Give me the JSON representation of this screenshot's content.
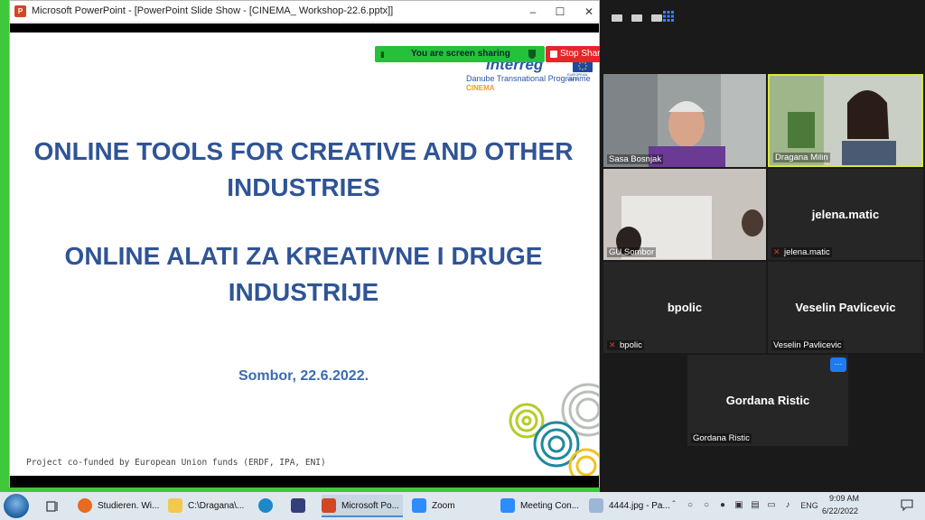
{
  "ppt_window": {
    "title": "Microsoft PowerPoint - [PowerPoint Slide Show - [CINEMA_ Workshop-22.6.pptx]]",
    "app_icon_letter": "P"
  },
  "slide": {
    "title_en": "ONLINE TOOLS FOR CREATIVE AND OTHER INDUSTRIES",
    "title_sr": "ONLINE ALATI ZA KREATIVNE I DRUGE INDUSTRIJE",
    "date": "Sombor, 22.6.2022.",
    "footer": "Project co-funded by European Union funds (ERDF, IPA, ENI)",
    "logo": {
      "brand": "interreg",
      "programme": "Danube Transnational Programme",
      "project": "CINEMA",
      "eu_label": "EUROPEAN UNION"
    }
  },
  "share_bar": {
    "status": "You are screen sharing",
    "stop_label": "Stop Share"
  },
  "zoom": {
    "participants": [
      {
        "name": "Sasa Bosnjak",
        "video": true
      },
      {
        "name": "Dragana Milin",
        "video": true,
        "active_speaker": true
      },
      {
        "name": "GU Sombor",
        "video": true
      },
      {
        "name": "jelena.matic",
        "display": "jelena.matic",
        "muted": true
      },
      {
        "name": "bpolic",
        "display": "bpolic",
        "muted": true
      },
      {
        "name": "Veselin Pavlicevic",
        "display": "Veselin Pavlicevic"
      },
      {
        "name": "Gordana Ristic",
        "display": "Gordana Ristic"
      }
    ],
    "more_label": "···"
  },
  "taskbar": {
    "items": [
      {
        "label": "Studieren. Wi..."
      },
      {
        "label": "C:\\Dragana\\..."
      },
      {
        "label": "Microsoft Po..."
      },
      {
        "label": "Zoom"
      },
      {
        "label": "Meeting Con..."
      },
      {
        "label": "4444.jpg - Pa..."
      }
    ],
    "lang": "ENG",
    "time": "9:09 AM",
    "date": "6/22/2022"
  },
  "colors": {
    "slide_heading": "#2f5496",
    "share_green": "#25c13a",
    "stop_red": "#e6252a",
    "zoom_bg": "#1a1a1a",
    "active_speaker_border": "#d9e83b"
  }
}
